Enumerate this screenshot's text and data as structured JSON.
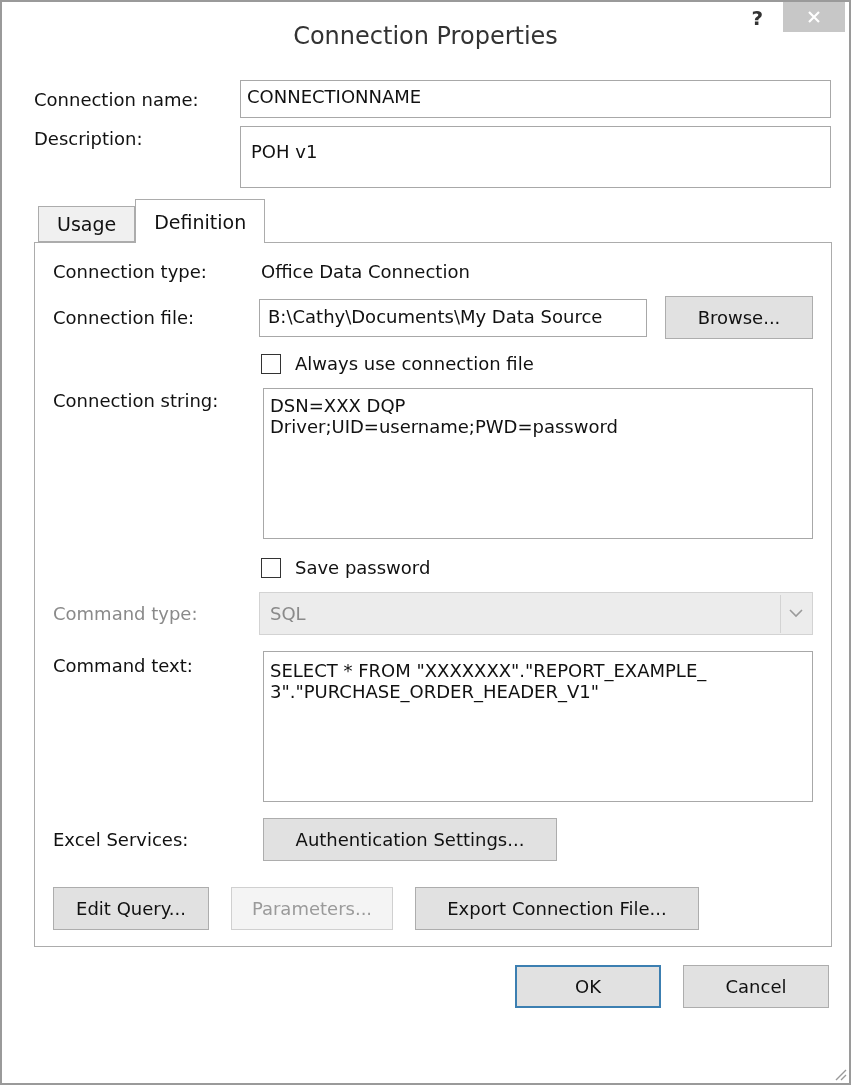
{
  "window": {
    "title": "Connection Properties",
    "help": "?"
  },
  "connection_name": {
    "label": "Connection name:",
    "value": "CONNECTIONNAME"
  },
  "description": {
    "label": "Description:",
    "value": "POH v1"
  },
  "tabs": [
    {
      "label": "Usage",
      "selected": false
    },
    {
      "label": "Definition",
      "selected": true
    }
  ],
  "definition": {
    "connection_type": {
      "label": "Connection type:",
      "value": "Office Data Connection"
    },
    "connection_file": {
      "label": "Connection file:",
      "value": "B:\\Cathy\\Documents\\My Data Source",
      "button": "Browse..."
    },
    "always_use": {
      "label": "Always use connection file",
      "checked": false
    },
    "connection_string": {
      "label": "Connection string:",
      "value": "DSN=XXX DQP\nDriver;UID=username;PWD=password"
    },
    "save_password": {
      "label": "Save password",
      "checked": false
    },
    "command_type": {
      "label": "Command type:",
      "value": "SQL",
      "disabled": true
    },
    "command_text": {
      "label": "Command text:",
      "value": "SELECT * FROM \"XXXXXXX\".\"REPORT_EXAMPLE_\n3\".\"PURCHASE_ORDER_HEADER_V1\""
    },
    "excel_services": {
      "label": "Excel Services:",
      "button": "Authentication Settings..."
    },
    "actions": [
      {
        "label": "Edit Query...",
        "disabled": false
      },
      {
        "label": "Parameters...",
        "disabled": true
      },
      {
        "label": "Export Connection File...",
        "disabled": false
      }
    ]
  },
  "buttons": [
    {
      "label": "OK",
      "default": true
    },
    {
      "label": "Cancel",
      "default": false
    }
  ]
}
